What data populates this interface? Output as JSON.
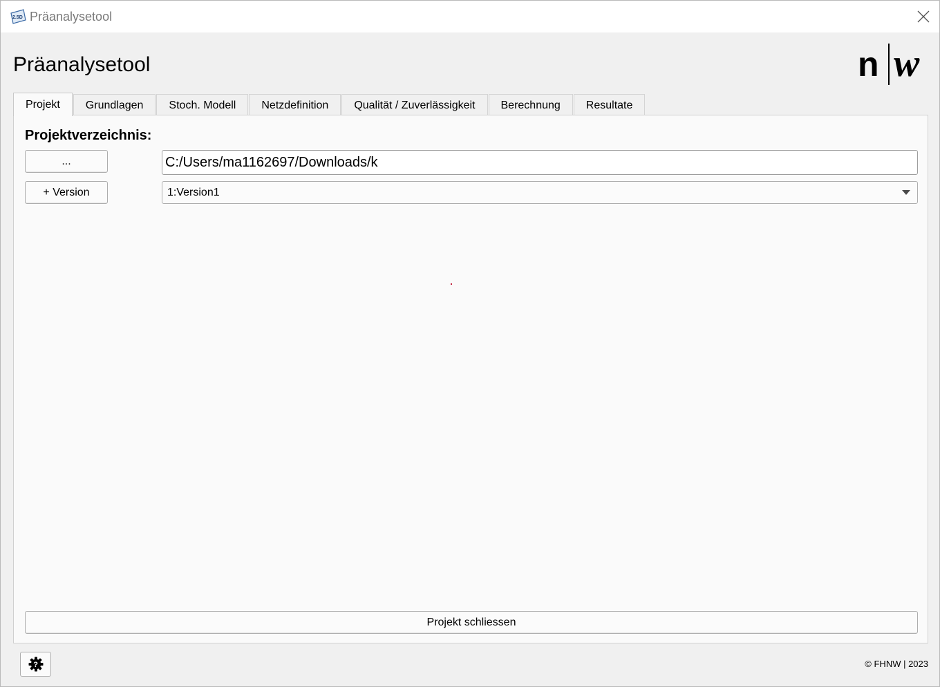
{
  "window": {
    "title": "Präanalysetool",
    "icon_text": "2.5D"
  },
  "header": {
    "heading": "Präanalysetool",
    "logo_left": "n",
    "logo_right": "w"
  },
  "tabs": [
    {
      "label": "Projekt",
      "active": true
    },
    {
      "label": "Grundlagen",
      "active": false
    },
    {
      "label": "Stoch. Modell",
      "active": false
    },
    {
      "label": "Netzdefinition",
      "active": false
    },
    {
      "label": "Qualität / Zuverlässigkeit",
      "active": false
    },
    {
      "label": "Berechnung",
      "active": false
    },
    {
      "label": "Resultate",
      "active": false
    }
  ],
  "projekt": {
    "section_label": "Projektverzeichnis:",
    "browse_label": "...",
    "path_value": "C:/Users/ma1162697/Downloads/k",
    "add_version_label": "+ Version",
    "version_selected": "1:Version1",
    "close_project_label": "Projekt schliessen"
  },
  "footer": {
    "copyright": "© FHNW | 2023",
    "settings_icon": "gear-question-icon"
  },
  "colors": {
    "window_bg": "#f0f0f0",
    "panel_bg": "#fafafa",
    "title_text": "#7a7a7a"
  }
}
